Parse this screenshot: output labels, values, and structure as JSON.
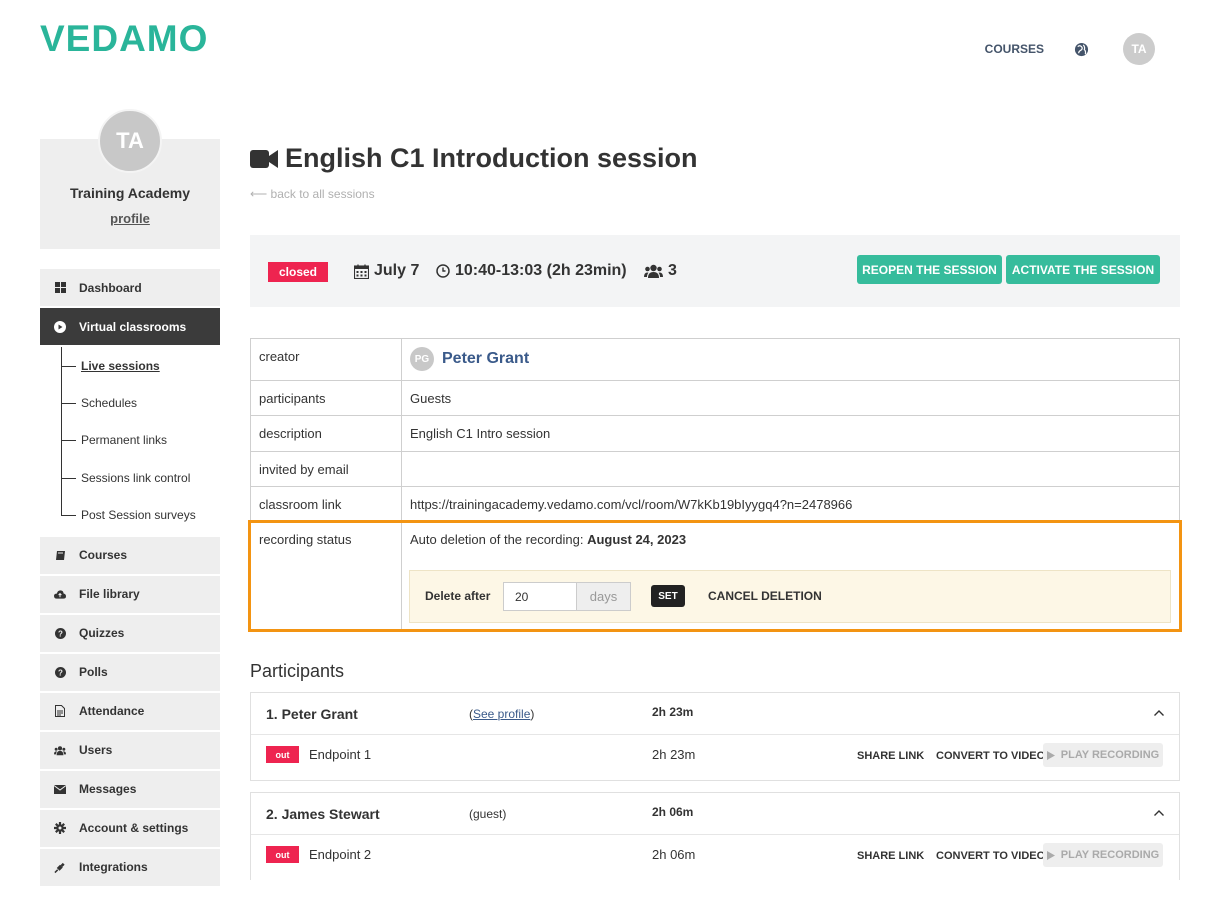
{
  "header": {
    "logo": "VEDAMO",
    "nav_courses": "COURSES",
    "avatar_initials": "TA"
  },
  "profile": {
    "initials": "TA",
    "name": "Training Academy",
    "link": "profile"
  },
  "sidebar": {
    "items": [
      {
        "label": "Dashboard",
        "icon": "grid-icon"
      },
      {
        "label": "Virtual classrooms",
        "icon": "play-circle-icon",
        "active": true
      },
      {
        "label": "Courses",
        "icon": "book-icon"
      },
      {
        "label": "File library",
        "icon": "cloud-upload-icon"
      },
      {
        "label": "Quizzes",
        "icon": "question-circle-icon"
      },
      {
        "label": "Polls",
        "icon": "question-circle-icon"
      },
      {
        "label": "Attendance",
        "icon": "document-icon"
      },
      {
        "label": "Users",
        "icon": "users-icon"
      },
      {
        "label": "Messages",
        "icon": "envelope-icon"
      },
      {
        "label": "Account & settings",
        "icon": "gear-icon"
      },
      {
        "label": "Integrations",
        "icon": "plug-icon"
      }
    ],
    "subitems": [
      {
        "label": "Live sessions",
        "current": true
      },
      {
        "label": "Schedules"
      },
      {
        "label": "Permanent links"
      },
      {
        "label": "Sessions link control"
      },
      {
        "label": "Post Session surveys"
      }
    ]
  },
  "session": {
    "title": "English C1 Introduction session",
    "back_link": "⟵ back to all sessions",
    "status": "closed",
    "date": "July 7",
    "time": "10:40-13:03 (2h 23min)",
    "participants_count": "3",
    "reopen_label": "REOPEN THE SESSION",
    "activate_label": "ACTIVATE THE SESSION"
  },
  "details": {
    "creator_label": "creator",
    "creator_initials": "PG",
    "creator_name": "Peter Grant",
    "participants_label": "participants",
    "participants_value": "Guests",
    "description_label": "description",
    "description_value": "English C1 Intro session",
    "invited_label": "invited by email",
    "invited_value": "",
    "link_label": "classroom link",
    "link_value": "https://trainingacademy.vedamo.com/vcl/room/W7kKb19bIyygq4?n=2478966",
    "recording_label": "recording status",
    "recording_prefix": "Auto deletion of the recording: ",
    "recording_date": "August 24, 2023",
    "delete_after_label": "Delete after",
    "delete_days_value": "20",
    "days_unit": "days",
    "set_label": "SET",
    "cancel_label": "CANCEL DELETION"
  },
  "participants": {
    "title": "Participants",
    "list": [
      {
        "name": "1. Peter Grant",
        "role_prefix": "(",
        "role_link": "See profile",
        "role_suffix": ")",
        "duration": "2h 23m",
        "status": "out",
        "endpoint": "Endpoint 1",
        "endpoint_duration": "2h 23m"
      },
      {
        "name": "2. James Stewart",
        "role": "(guest)",
        "duration": "2h 06m",
        "status": "out",
        "endpoint": "Endpoint 2",
        "endpoint_duration": "2h 06m"
      }
    ],
    "share_label": "SHARE LINK",
    "convert_label": "CONVERT TO VIDEO",
    "play_label": "PLAY RECORDING"
  },
  "colors": {
    "brand": "#2ab59a",
    "accent_green": "#36bc9c",
    "status_red": "#ee2450",
    "highlight_orange": "#f39412",
    "sidebar_active": "#3b3b3b"
  }
}
